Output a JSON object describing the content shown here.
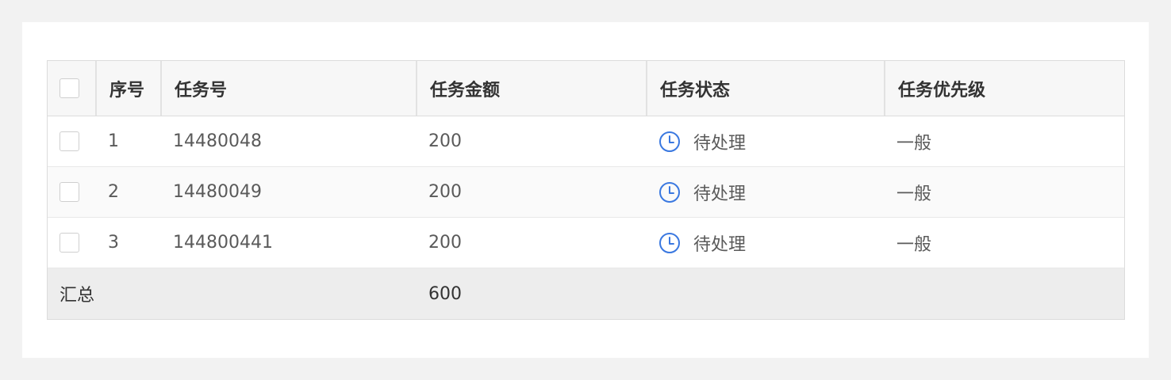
{
  "table": {
    "columns": [
      "序号",
      "任务号",
      "任务金额",
      "任务状态",
      "任务优先级"
    ],
    "rows": [
      {
        "index": "1",
        "task_no": "14480048",
        "amount": "200",
        "status": "待处理",
        "priority": "一般"
      },
      {
        "index": "2",
        "task_no": "14480049",
        "amount": "200",
        "status": "待处理",
        "priority": "一般"
      },
      {
        "index": "3",
        "task_no": "144800441",
        "amount": "200",
        "status": "待处理",
        "priority": "一般"
      }
    ],
    "summary": {
      "label": "汇总",
      "amount": "600"
    }
  },
  "icons": {
    "status": "clock-icon"
  },
  "colors": {
    "status_icon": "#3a78e0"
  }
}
